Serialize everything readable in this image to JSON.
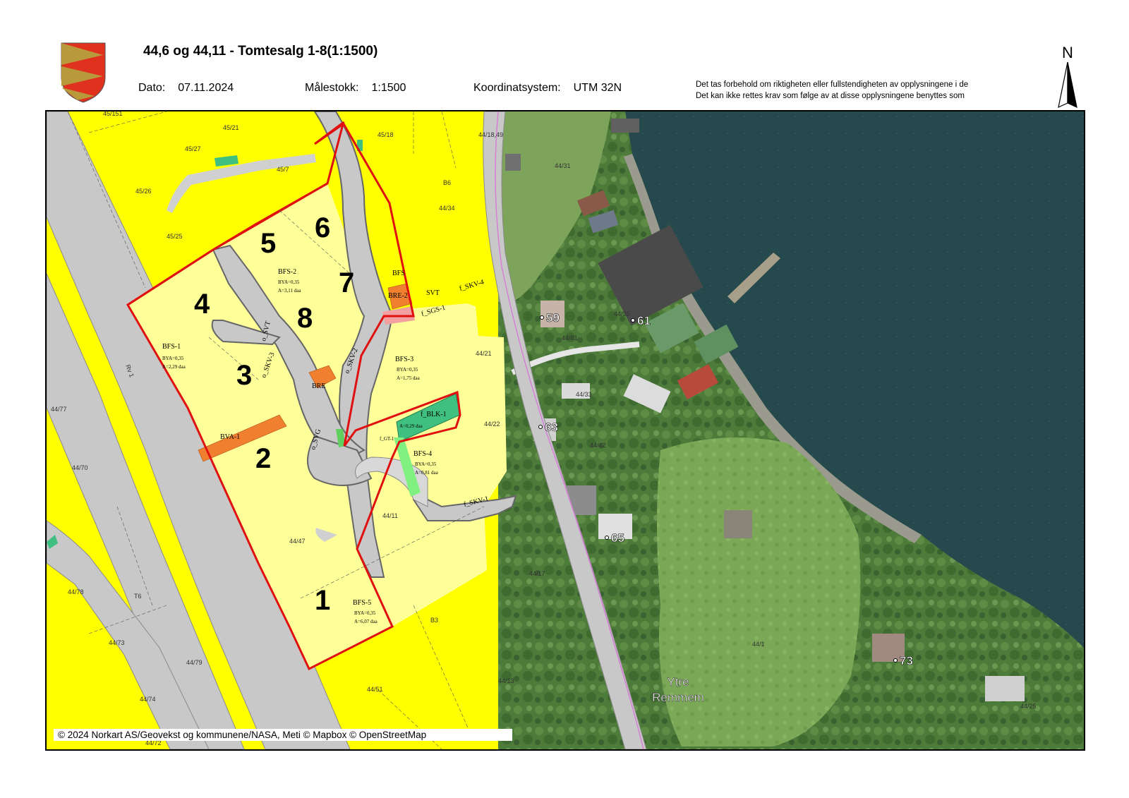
{
  "header": {
    "title": "44,6 og 44,11 - Tomtesalg 1-8(1:1500)",
    "date_label": "Dato:",
    "date_value": "07.11.2024",
    "scale_label": "Målestokk:",
    "scale_value": "1:1500",
    "crs_label": "Koordinatsystem:",
    "crs_value": "UTM 32N",
    "disclaimer_line1": "Det tas forbehold om riktigheten eller fullstendigheten av opplysningene i de",
    "disclaimer_line2": "Det kan ikke rettes krav som følge av at disse opplysningene benyttes som"
  },
  "north_arrow": {
    "label": "N"
  },
  "colors": {
    "residential_zone": "#ffff00",
    "plot_area": "#ffff99",
    "road": "#c8c8c8",
    "plan_boundary": "#e01010",
    "orange_strip": "#f08030",
    "green_zone": "#40c080",
    "water": "#23474c",
    "vegetation": "#4a7a38"
  },
  "map": {
    "plots": [
      {
        "number": "1"
      },
      {
        "number": "2"
      },
      {
        "number": "3"
      },
      {
        "number": "4"
      },
      {
        "number": "5"
      },
      {
        "number": "6"
      },
      {
        "number": "7"
      },
      {
        "number": "8"
      }
    ],
    "zones": {
      "bfs1": "BFS-1",
      "bfs1_bya": "BYA=0,35",
      "bfs1_a": "A=2,29 daa",
      "bfs2": "BFS-2",
      "bfs2_bya": "BYA=0,35",
      "bfs2_a": "A=3,11 daa",
      "bfs3": "BFS-3",
      "bfs3_bya": "BYA=0,35",
      "bfs3_a": "A=1,75 daa",
      "bfs4": "BFS-4",
      "bfs4_bya": "BYA=0,35",
      "bfs4_a": "A=0,81 daa",
      "bfs5": "BFS-5",
      "bfs5_bya": "BYA=0,35",
      "bfs5_a": "A=6,07 daa",
      "bva1": "BVA-1",
      "bre": "BRE",
      "bre2": "BRE-2",
      "bfs": "BFS",
      "blk1": "f_BLK-1",
      "blk1_a": "A=0,29 daa",
      "svt": "SVT",
      "sgs1": "f_SGS-1",
      "skv4": "f_SKV-4",
      "skv1": "f_SKV-1",
      "skv3": "o_SKV-3",
      "skv2": "o_SKV-2",
      "svt_o": "o_SVT",
      "svg": "o_SVG",
      "ct1": "f_GT-1"
    },
    "parcels": [
      "45/151",
      "45/21",
      "45/27",
      "45/7",
      "45/18",
      "45/26",
      "45/25",
      "44/18,49",
      "B6",
      "44/34",
      "44/21",
      "44/22",
      "44/77",
      "44/70",
      "44/47",
      "44/11",
      "44/78",
      "44/73",
      "44/79",
      "44/74",
      "44/72",
      "44/51",
      "44/13",
      "44/17",
      "B3",
      "T6",
      "Rv 1",
      "44/31",
      "44/81",
      "44/35",
      "44/33",
      "44/42",
      "44/25",
      "44/1"
    ],
    "house_numbers": [
      "59",
      "61",
      "63",
      "65",
      "73"
    ],
    "place_name_line1": "Ytre",
    "place_name_line2": "Remmem"
  },
  "credit": "© 2024 Norkart AS/Geovekst og kommunene/NASA, Meti © Mapbox © OpenStreetMap"
}
